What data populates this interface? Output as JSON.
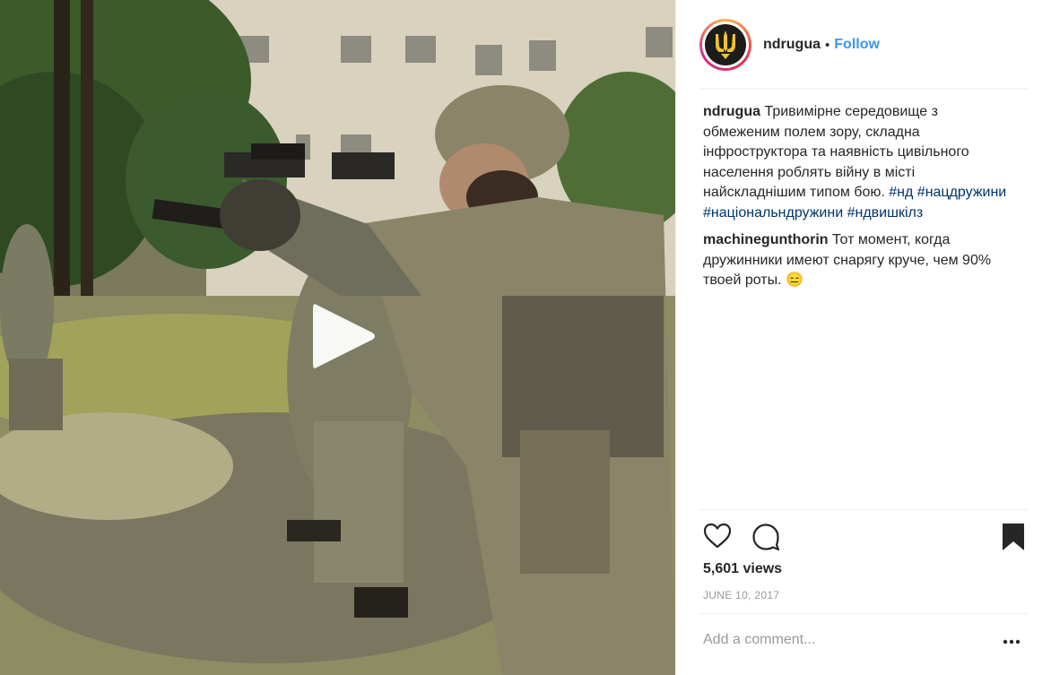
{
  "post": {
    "username": "ndrugua",
    "separator": "•",
    "follow_label": "Follow",
    "comments": [
      {
        "author": "ndrugua",
        "text": "Тривимірне середовище з обмеженим полем зору, складна інфроструктора та наявність цивільного населення роблять війну в місті найскладнішим типом бою.",
        "hashtags": [
          "#нд",
          "#нацдружини",
          "#національндружини",
          "#ндвишкілз"
        ]
      },
      {
        "author": "machinegunthorin",
        "text": "Тот момент, когда дружинники имеют снарягу круче, чем 90% твоей роты.",
        "emoji": "😑"
      }
    ],
    "views": "5,601 views",
    "date": "JUNE 10, 2017",
    "add_comment_placeholder": "Add a comment...",
    "more_label": "•••"
  },
  "icons": {
    "like": "heart-icon",
    "comment": "speech-bubble-icon",
    "save": "bookmark-icon",
    "play": "play-icon",
    "more": "ellipsis-icon"
  },
  "colors": {
    "link": "#3897f0",
    "hashtag": "#003569",
    "muted": "#999999",
    "text": "#262626"
  }
}
